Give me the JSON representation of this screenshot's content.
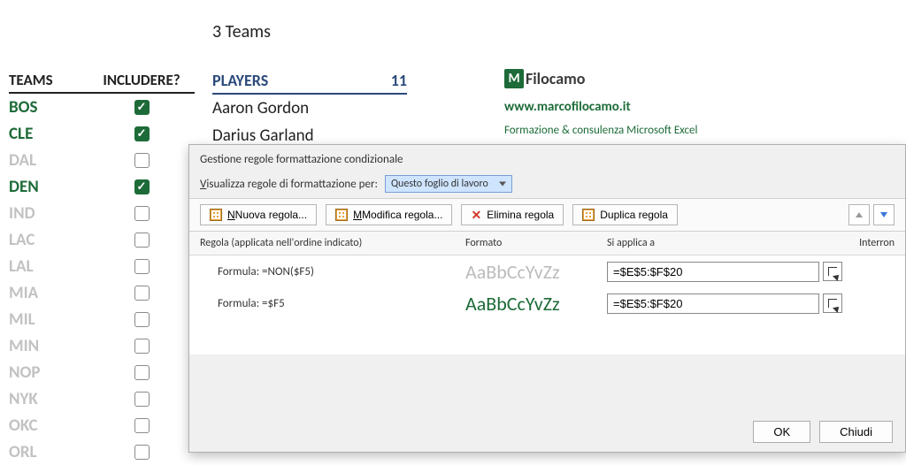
{
  "summary": {
    "text": "3 Teams"
  },
  "headers": {
    "teams": "TEAMS",
    "include": "INCLUDERE?",
    "players": "PLAYERS",
    "player_count": "11"
  },
  "teams": [
    {
      "name": "BOS",
      "checked": true
    },
    {
      "name": "CLE",
      "checked": true
    },
    {
      "name": "DAL",
      "checked": false
    },
    {
      "name": "DEN",
      "checked": true
    },
    {
      "name": "IND",
      "checked": false
    },
    {
      "name": "LAC",
      "checked": false
    },
    {
      "name": "LAL",
      "checked": false
    },
    {
      "name": "MIA",
      "checked": false
    },
    {
      "name": "MIL",
      "checked": false
    },
    {
      "name": "MIN",
      "checked": false
    },
    {
      "name": "NOP",
      "checked": false
    },
    {
      "name": "NYK",
      "checked": false
    },
    {
      "name": "OKC",
      "checked": false
    },
    {
      "name": "ORL",
      "checked": false
    }
  ],
  "players": [
    "Aaron Gordon",
    "Darius Garland"
  ],
  "branding": {
    "logo_letter": "M",
    "logo_name": "Filocamo",
    "url": "www.marcofilocamo.it",
    "tagline": "Formazione & consulenza Microsoft Excel"
  },
  "dialog": {
    "title": "Gestione regole formattazione condizionale",
    "show_label_pre": "V",
    "show_label": "isualizza regole di formattazione per:",
    "scope_selected": "Questo foglio di lavoro",
    "toolbar": {
      "new_rule": "Nuova regola...",
      "edit_rule": "Modifica regola...",
      "delete_rule": "Elimina regola",
      "duplicate_rule": "Duplica regola"
    },
    "columns": {
      "rule": "Regola (applicata nell'ordine indicato)",
      "format": "Formato",
      "applies": "Si applica a",
      "stop": "Interron"
    },
    "rules": [
      {
        "formula": "Formula: =NON($F5)",
        "sample": "AaBbCcYvZz",
        "style": "gray",
        "range": "=$E$5:$F$20"
      },
      {
        "formula": "Formula: =$F5",
        "sample": "AaBbCcYvZz",
        "style": "green",
        "range": "=$E$5:$F$20"
      }
    ],
    "buttons": {
      "ok": "OK",
      "close": "Chiudi"
    }
  }
}
